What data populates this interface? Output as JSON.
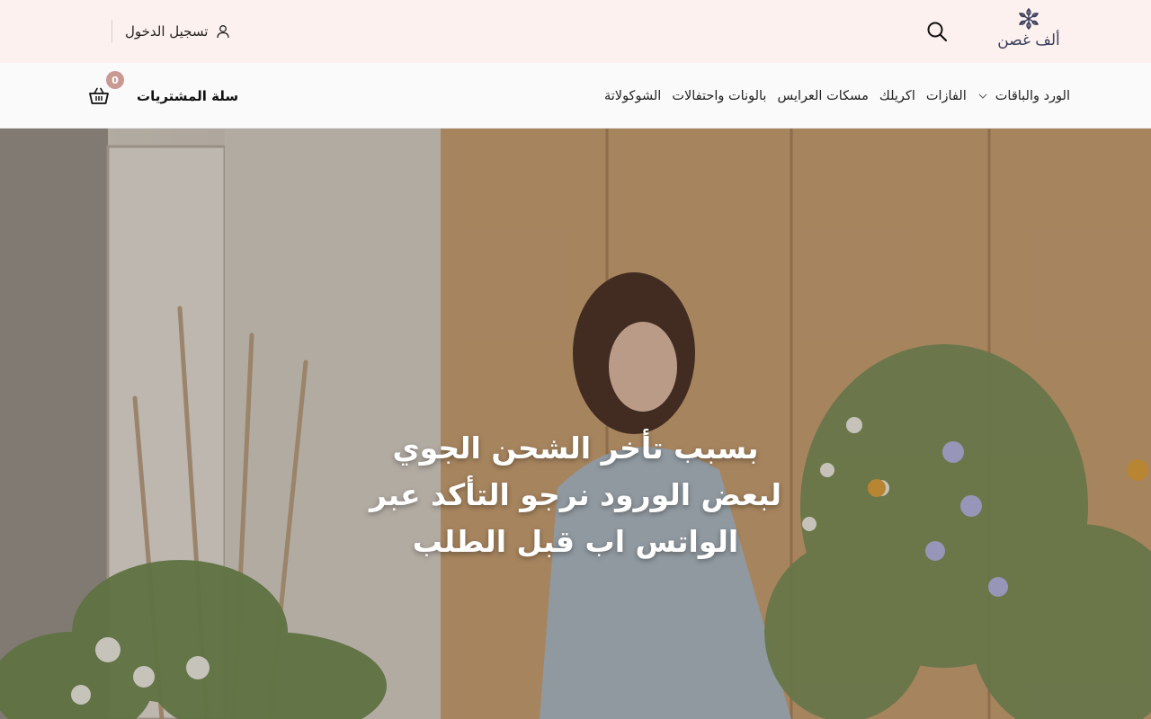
{
  "brand": {
    "logo_text": "ألف غصن"
  },
  "header": {
    "login_label": "تسجيل الدخول",
    "search_icon": "search-icon",
    "user_icon": "user-icon"
  },
  "nav": {
    "items": [
      {
        "label": "الورد والباقات",
        "has_dropdown": true
      },
      {
        "label": "الفازات"
      },
      {
        "label": "اكريلك"
      },
      {
        "label": "مسكات العرايس"
      },
      {
        "label": "بالونات واحتفالات"
      },
      {
        "label": "الشوكولاتة"
      }
    ]
  },
  "cart": {
    "label": "سلة المشتريات",
    "count": "0",
    "icon": "basket-icon"
  },
  "hero": {
    "lines": [
      "بسبب تأخر الشحن الجوي",
      "لبعض الورود نرجو التأكد عبر",
      "الواتس اب قبل الطلب"
    ]
  },
  "colors": {
    "topbar_bg": "#fcf1ee",
    "navbar_bg": "#fafafa",
    "badge": "#c99a92",
    "logo": "#3a3f5c"
  }
}
